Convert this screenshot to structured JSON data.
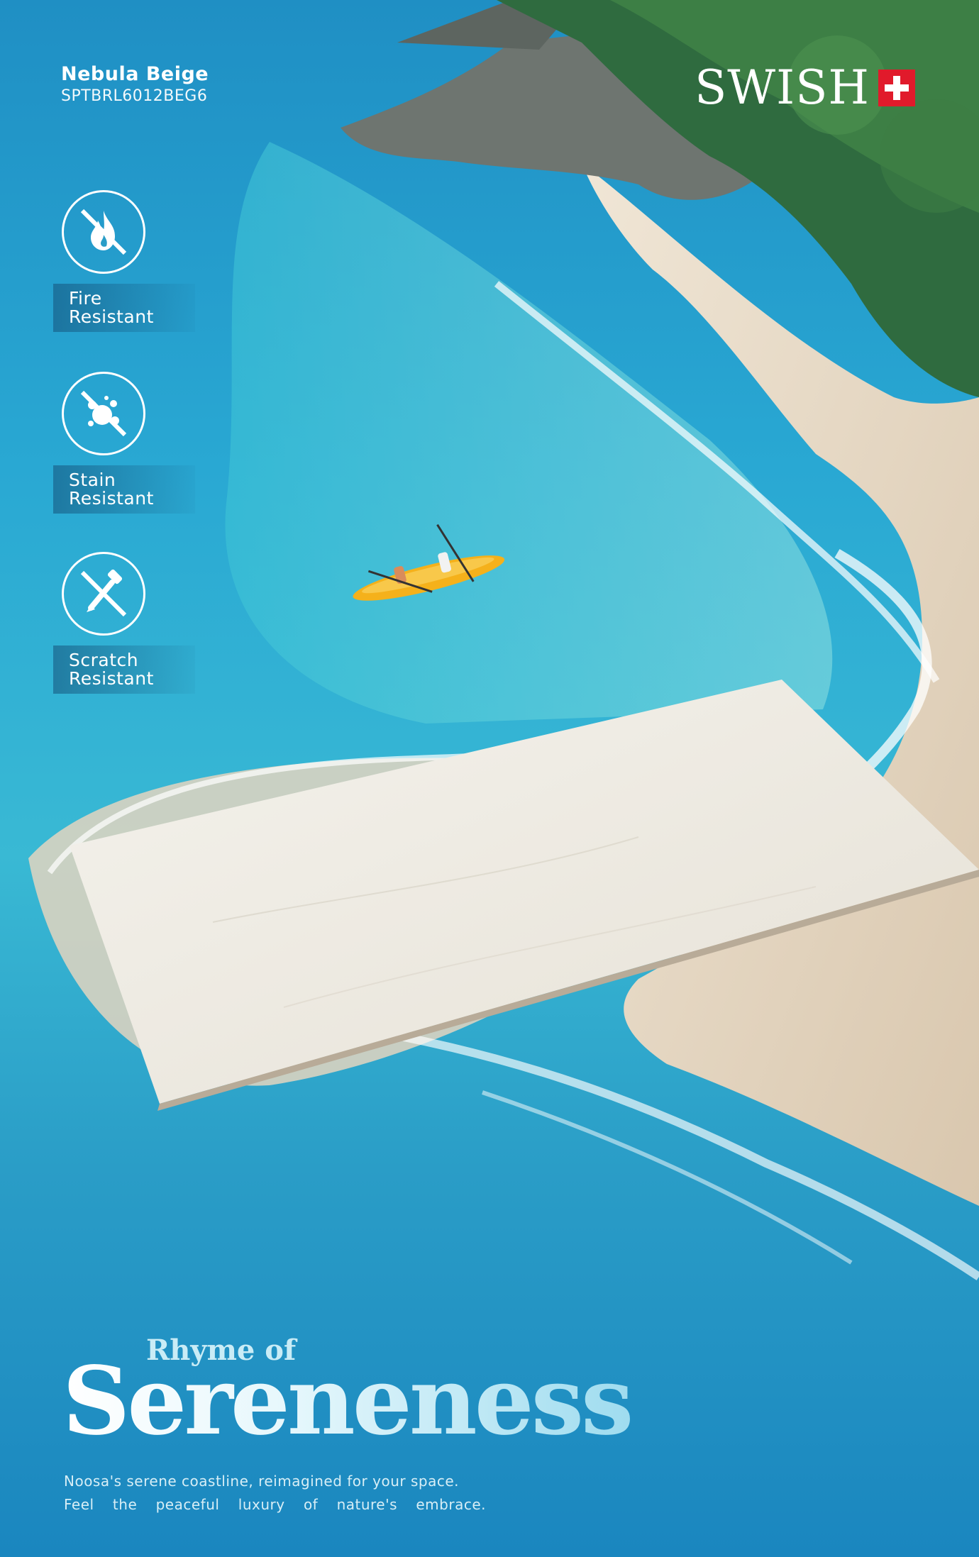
{
  "product": {
    "name": "Nebula Beige",
    "code": "SPTBRL6012BEG6"
  },
  "brand": {
    "name": "SWISH",
    "flag_color": "#e11a2b"
  },
  "features": [
    {
      "icon": "no-fire-icon",
      "line1": "Fire",
      "line2": "Resistant"
    },
    {
      "icon": "no-stain-icon",
      "line1": "Stain",
      "line2": "Resistant"
    },
    {
      "icon": "no-scratch-icon",
      "line1": "Scratch",
      "line2": "Resistant"
    }
  ],
  "tagline": {
    "small": "Rhyme of",
    "big": "Sereneness"
  },
  "description": {
    "line1": "Noosa's serene coastline, reimagined for your space.",
    "line2": "Feel the peaceful luxury of nature's embrace."
  },
  "colors": {
    "sea": "#29a8d3",
    "sand": "#e9dcc8",
    "tile": "#eeebe3"
  }
}
